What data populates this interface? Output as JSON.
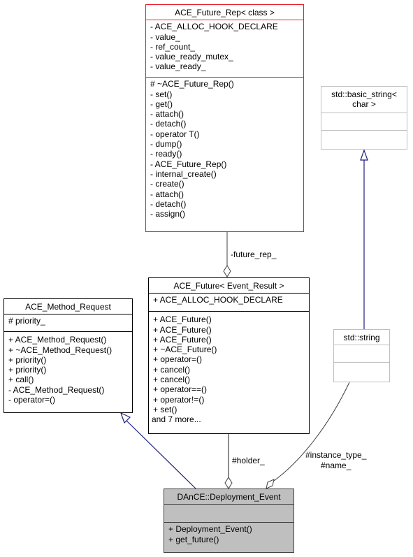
{
  "diagram": {
    "classes": {
      "future_rep": {
        "name": "ACE_Future_Rep< class >",
        "attributes": [
          "- ACE_ALLOC_HOOK_DECLARE",
          "- value_",
          "- ref_count_",
          "- value_ready_mutex_",
          "- value_ready_"
        ],
        "methods": [
          "# ~ACE_Future_Rep()",
          "- set()",
          "- get()",
          "- attach()",
          "- detach()",
          "- operator T()",
          "- dump()",
          "- ready()",
          "- ACE_Future_Rep()",
          "- internal_create()",
          "- create()",
          "- attach()",
          "- detach()",
          "- assign()"
        ]
      },
      "basic_string": {
        "name": "std::basic_string< char >",
        "name_line1": "std::basic_string<",
        "name_line2": "char >",
        "attributes": [],
        "methods": []
      },
      "future": {
        "name": "ACE_Future< Event_Result >",
        "attributes": [
          "+ ACE_ALLOC_HOOK_DECLARE"
        ],
        "methods": [
          "+ ACE_Future()",
          "+ ACE_Future()",
          "+ ACE_Future()",
          "+ ~ACE_Future()",
          "+ operator=()",
          "+ cancel()",
          "+ cancel()",
          "+ operator==()",
          "+ operator!=()",
          "+ set()",
          "and 7 more..."
        ]
      },
      "method_request": {
        "name": "ACE_Method_Request",
        "attributes": [
          "# priority_"
        ],
        "methods": [
          "+ ACE_Method_Request()",
          "+ ~ACE_Method_Request()",
          "+ priority()",
          "+ priority()",
          "+ call()",
          "- ACE_Method_Request()",
          "- operator=()"
        ]
      },
      "std_string": {
        "name": "std::string",
        "attributes": [],
        "methods": []
      },
      "deployment_event": {
        "name": "DAnCE::Deployment_Event",
        "attributes": [],
        "methods": [
          "+ Deployment_Event()",
          "+ get_future()"
        ]
      }
    },
    "edges": [
      {
        "from": "future_rep",
        "to": "future",
        "kind": "aggregation",
        "label": "-future_rep_"
      },
      {
        "from": "basic_string",
        "to": "std_string",
        "kind": "inheritance",
        "label": ""
      },
      {
        "from": "method_request",
        "to": "deployment_event",
        "kind": "inheritance",
        "label": ""
      },
      {
        "from": "future",
        "to": "deployment_event",
        "kind": "aggregation",
        "label": "#holder_"
      },
      {
        "from": "std_string",
        "to": "deployment_event",
        "kind": "aggregation",
        "label_line1": "#instance_type_",
        "label_line2": "#name_"
      }
    ],
    "colors": {
      "template_border": "#e8202a",
      "external_border": "#bfbfbf",
      "focus_fill": "#bfbfbf",
      "inheritance_edge": "#1f1f7f",
      "aggregation_edge": "#404040"
    }
  }
}
